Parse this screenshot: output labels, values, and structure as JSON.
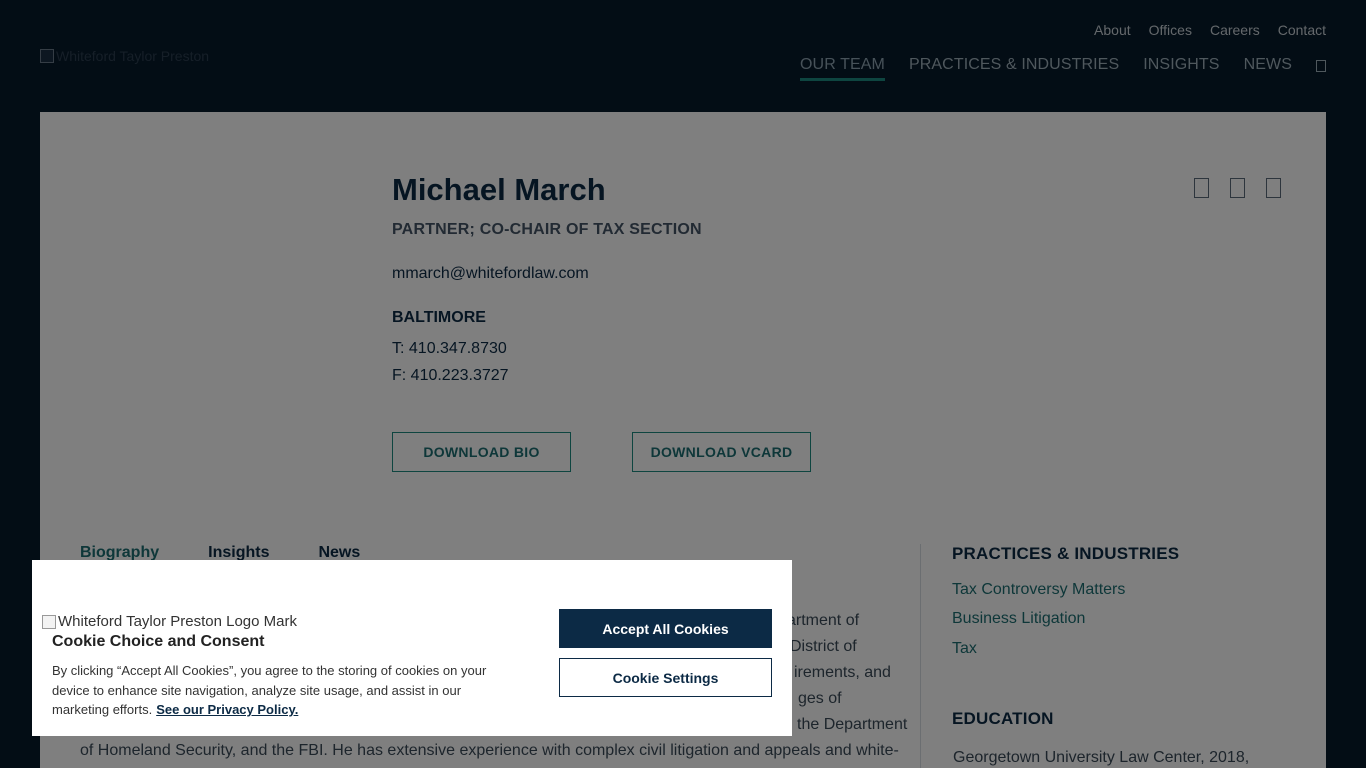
{
  "header": {
    "logo_alt": "Whiteford Taylor Preston",
    "utility_nav": [
      "About",
      "Offices",
      "Careers",
      "Contact"
    ],
    "main_nav": [
      "OUR TEAM",
      "PRACTICES & INDUSTRIES",
      "INSIGHTS",
      "NEWS"
    ],
    "active_nav": "OUR TEAM"
  },
  "profile": {
    "name": "Michael March",
    "title": "PARTNER; CO-CHAIR OF TAX SECTION",
    "email": "mmarch@whitefordlaw.com",
    "office": "BALTIMORE",
    "phone": "T: 410.347.8730",
    "fax": "F: 410.223.3727",
    "download_bio": "DOWNLOAD BIO",
    "download_vcard": "DOWNLOAD VCARD"
  },
  "tabs": [
    "Biography",
    "Insights",
    "News"
  ],
  "bio": {
    "lines": [
      "artment of",
      "District of",
      "irements, and",
      "ges of",
      "the Department",
      "of Homeland Security, and the FBI. He has extensive experience with complex civil litigation and appeals and white-"
    ]
  },
  "sidebar": {
    "practices_heading": "PRACTICES & INDUSTRIES",
    "practices": [
      "Tax Controversy Matters",
      "Business Litigation",
      "Tax"
    ],
    "education_heading": "EDUCATION",
    "education_first": "Georgetown University Law Center, 2018,"
  },
  "cookie": {
    "logo_alt": "Whiteford Taylor Preston Logo Mark",
    "title": "Cookie Choice and Consent",
    "text": "By clicking “Accept All Cookies”, you agree to the storing of cookies on your device to enhance site navigation, analyze site usage, and assist in our marketing efforts.",
    "privacy_link": "See our Privacy Policy.",
    "accept_label": "Accept All Cookies",
    "settings_label": "Cookie Settings"
  }
}
